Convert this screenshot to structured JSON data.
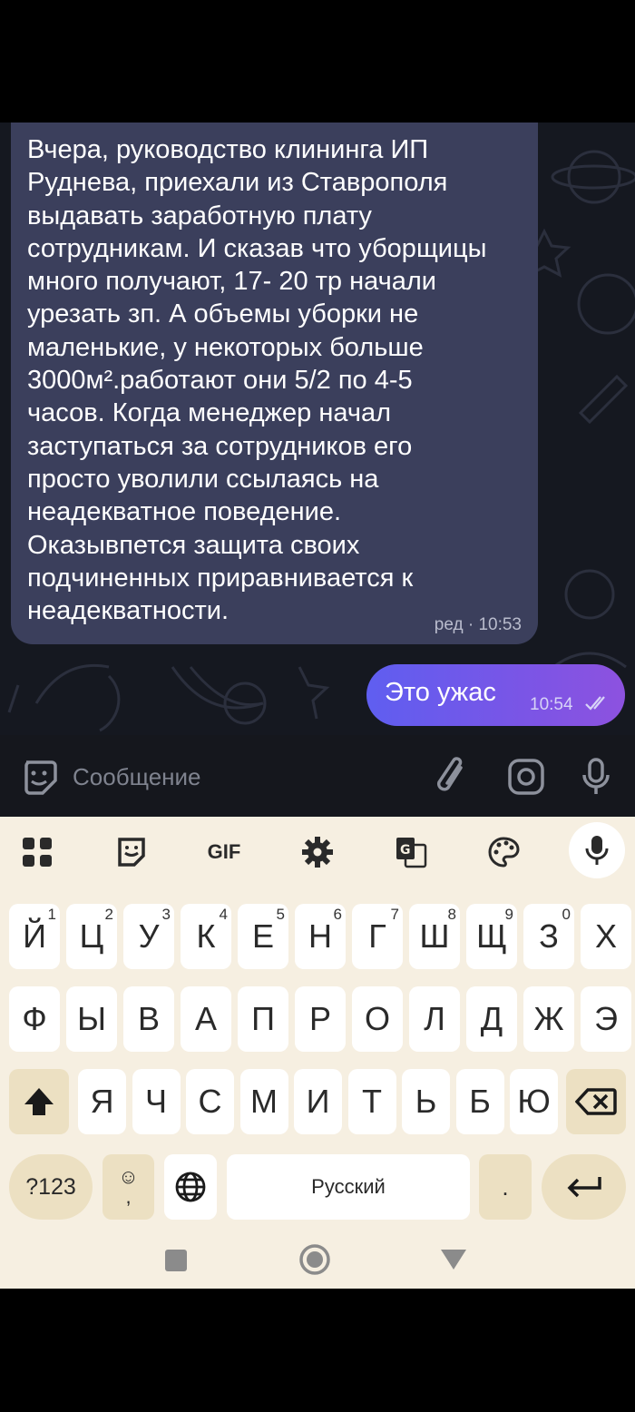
{
  "messages": {
    "incoming": {
      "text": "Вчера, руководство клининга ИП\nРуднева, приехали из Ставрополя\nвыдавать заработную плату\nсотрудникам. И сказав что уборщицы\nмного получают, 17- 20 тр начали\nурезать зп. А объемы уборки не\nмаленькие, у некоторых больше\n3000м².работают они 5/2 по 4-5\nчасов. Когда менеджер начал\nзаступаться за сотрудников его\nпросто уволили ссылаясь на\nнеадекватное поведение.\nОказывпется защита своих\nподчиненных приравнивается к\nнеадекватности.",
      "meta": "ред · 10:53"
    },
    "outgoing": {
      "text": "Это ужас",
      "time": "10:54",
      "status_icon": "double-check-icon"
    }
  },
  "composer": {
    "placeholder": "Сообщение",
    "icons": [
      "sticker-icon",
      "attach-icon",
      "camera-icon",
      "mic-icon"
    ]
  },
  "keyboard": {
    "toolbar": [
      "apps-grid-icon",
      "sticker-icon",
      "GIF",
      "settings-icon",
      "translate-icon",
      "palette-icon",
      "mic-icon"
    ],
    "gif_label": "GIF",
    "row1": [
      {
        "label": "Й",
        "hint": "1"
      },
      {
        "label": "Ц",
        "hint": "2"
      },
      {
        "label": "У",
        "hint": "3"
      },
      {
        "label": "К",
        "hint": "4"
      },
      {
        "label": "Е",
        "hint": "5"
      },
      {
        "label": "Н",
        "hint": "6"
      },
      {
        "label": "Г",
        "hint": "7"
      },
      {
        "label": "Ш",
        "hint": "8"
      },
      {
        "label": "Щ",
        "hint": "9"
      },
      {
        "label": "З",
        "hint": "0"
      },
      {
        "label": "Х",
        "hint": ""
      }
    ],
    "row2": [
      "Ф",
      "Ы",
      "В",
      "А",
      "П",
      "Р",
      "О",
      "Л",
      "Д",
      "Ж",
      "Э"
    ],
    "row3": [
      "Я",
      "Ч",
      "С",
      "М",
      "И",
      "Т",
      "Ь",
      "Б",
      "Ю"
    ],
    "symbols_label": "?123",
    "emoji_label": "☺",
    "comma_label": ",",
    "space_label": "Русский",
    "period_label": ".",
    "colors": {
      "background": "#f6efe1",
      "key": "#ffffff",
      "special_key": "#ece0c2"
    }
  },
  "navigation": [
    "back-icon",
    "home-icon",
    "recents-icon"
  ],
  "colors": {
    "chat_background": "#151820",
    "incoming_bubble": "#3b3f5c",
    "outgoing_bubble_start": "#5f5ef0",
    "outgoing_bubble_end": "#8d52df"
  }
}
